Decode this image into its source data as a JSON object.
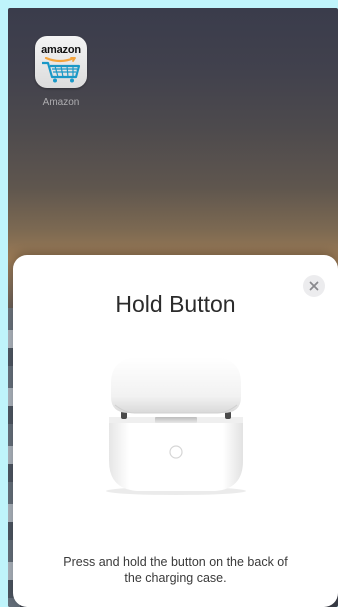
{
  "home_screen": {
    "app": {
      "icon_text": "amazon",
      "label": "Amazon",
      "icon": "amazon-cart-icon"
    }
  },
  "sheet": {
    "title": "Hold Button",
    "instructions": "Press and hold the button on the back of the charging case.",
    "close_icon": "close-icon",
    "image": "airpods-charging-case"
  },
  "colors": {
    "sheet_background": "#ffffff",
    "title_text": "#2b2b2b",
    "close_button_bg": "#ececee",
    "amazon_cart": "#1a98c7",
    "amazon_smile": "#f3a33c"
  }
}
